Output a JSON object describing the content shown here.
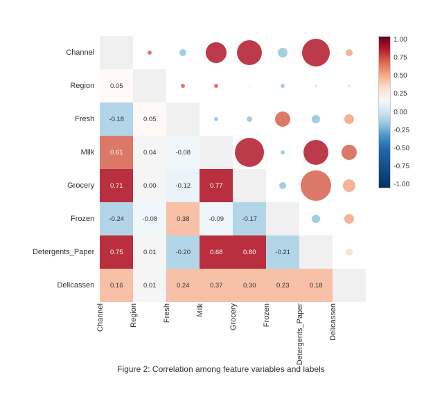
{
  "title": "Figure 2: Correlation among feature variables and labels",
  "rowLabels": [
    "Channel",
    "Region",
    "Fresh",
    "Milk",
    "Grocery",
    "Frozen",
    "Detergents_Paper",
    "Delicassen"
  ],
  "colLabels": [
    "Channel",
    "Region",
    "Fresh",
    "Milk",
    "Grocery",
    "Frozen",
    "Detergents_Paper",
    "Delicassen"
  ],
  "legend": {
    "values": [
      "1.00",
      "0.75",
      "0.50",
      "0.25",
      "0.00",
      "-0.25",
      "-0.50",
      "-0.75",
      "-1.00"
    ]
  },
  "cells": [
    [
      null,
      null,
      null,
      null,
      null,
      null,
      null,
      null
    ],
    [
      {
        "v": 0.05,
        "type": "num"
      },
      null,
      null,
      null,
      null,
      null,
      null,
      null
    ],
    [
      {
        "v": -0.18,
        "type": "num"
      },
      {
        "v": 0.05,
        "type": "num"
      },
      null,
      null,
      null,
      null,
      null,
      null
    ],
    [
      {
        "v": 0.61,
        "type": "num"
      },
      {
        "v": 0.04,
        "type": "num"
      },
      {
        "v": -0.08,
        "type": "num"
      },
      null,
      null,
      null,
      null,
      null
    ],
    [
      {
        "v": 0.71,
        "type": "num"
      },
      {
        "v": 0.0,
        "type": "num"
      },
      {
        "v": -0.12,
        "type": "num"
      },
      {
        "v": 0.77,
        "type": "num"
      },
      null,
      null,
      null,
      null
    ],
    [
      {
        "v": -0.24,
        "type": "num"
      },
      {
        "v": -0.08,
        "type": "num"
      },
      {
        "v": 0.38,
        "type": "num"
      },
      {
        "v": -0.09,
        "type": "num"
      },
      {
        "v": -0.17,
        "type": "num"
      },
      null,
      null,
      null
    ],
    [
      {
        "v": 0.75,
        "type": "num"
      },
      {
        "v": 0.01,
        "type": "num"
      },
      {
        "v": -0.2,
        "type": "num"
      },
      {
        "v": 0.68,
        "type": "num"
      },
      {
        "v": 0.8,
        "type": "num"
      },
      {
        "v": -0.21,
        "type": "num"
      },
      null,
      null
    ],
    [
      {
        "v": 0.16,
        "type": "num"
      },
      {
        "v": 0.01,
        "type": "num"
      },
      {
        "v": 0.24,
        "type": "num"
      },
      {
        "v": 0.37,
        "type": "num"
      },
      {
        "v": 0.3,
        "type": "num"
      },
      {
        "v": 0.23,
        "type": "num"
      },
      {
        "v": 0.18,
        "type": "num"
      },
      null
    ]
  ],
  "upperBubbles": [
    {
      "row": 0,
      "col": 1,
      "v": 0.05,
      "r": 3,
      "color": "#d6604d"
    },
    {
      "row": 0,
      "col": 2,
      "v": -0.18,
      "r": 5,
      "color": "#92c5de"
    },
    {
      "row": 0,
      "col": 3,
      "v": 0.61,
      "r": 15,
      "color": "#b2182b"
    },
    {
      "row": 0,
      "col": 4,
      "v": 0.71,
      "r": 18,
      "color": "#b2182b"
    },
    {
      "row": 0,
      "col": 5,
      "v": -0.24,
      "r": 7,
      "color": "#92c5de"
    },
    {
      "row": 0,
      "col": 6,
      "v": 0.75,
      "r": 20,
      "color": "#b2182b"
    },
    {
      "row": 0,
      "col": 7,
      "v": 0.16,
      "r": 5,
      "color": "#f4a582"
    },
    {
      "row": 1,
      "col": 2,
      "v": 0.05,
      "r": 3,
      "color": "#d6604d"
    },
    {
      "row": 1,
      "col": 3,
      "v": 0.04,
      "r": 3,
      "color": "#d6604d"
    },
    {
      "row": 1,
      "col": 4,
      "v": 0.0,
      "r": 2,
      "color": "#f7f7f7"
    },
    {
      "row": 1,
      "col": 5,
      "v": -0.08,
      "r": 3,
      "color": "#92c5de"
    },
    {
      "row": 1,
      "col": 6,
      "v": 0.01,
      "r": 2,
      "color": "#fddbc7"
    },
    {
      "row": 1,
      "col": 7,
      "v": 0.01,
      "r": 2,
      "color": "#fddbc7"
    },
    {
      "row": 2,
      "col": 3,
      "v": -0.08,
      "r": 3,
      "color": "#92c5de"
    },
    {
      "row": 2,
      "col": 4,
      "v": -0.12,
      "r": 4,
      "color": "#92c5de"
    },
    {
      "row": 2,
      "col": 5,
      "v": 0.38,
      "r": 11,
      "color": "#d6604d"
    },
    {
      "row": 2,
      "col": 6,
      "v": -0.2,
      "r": 6,
      "color": "#92c5de"
    },
    {
      "row": 2,
      "col": 7,
      "v": 0.24,
      "r": 7,
      "color": "#f4a582"
    },
    {
      "row": 3,
      "col": 4,
      "v": 0.77,
      "r": 21,
      "color": "#b2182b"
    },
    {
      "row": 3,
      "col": 5,
      "v": -0.09,
      "r": 3,
      "color": "#92c5de"
    },
    {
      "row": 3,
      "col": 6,
      "v": 0.68,
      "r": 18,
      "color": "#b2182b"
    },
    {
      "row": 3,
      "col": 7,
      "v": 0.37,
      "r": 11,
      "color": "#d6604d"
    },
    {
      "row": 4,
      "col": 5,
      "v": -0.17,
      "r": 5,
      "color": "#92c5de"
    },
    {
      "row": 4,
      "col": 6,
      "v": 0.8,
      "r": 22,
      "color": "#d6604d"
    },
    {
      "row": 4,
      "col": 7,
      "v": 0.3,
      "r": 9,
      "color": "#f4a582"
    },
    {
      "row": 5,
      "col": 6,
      "v": -0.21,
      "r": 6,
      "color": "#92c5de"
    },
    {
      "row": 5,
      "col": 7,
      "v": 0.23,
      "r": 7,
      "color": "#f4a582"
    },
    {
      "row": 6,
      "col": 7,
      "v": 0.18,
      "r": 5,
      "color": "#fddbc7"
    }
  ]
}
